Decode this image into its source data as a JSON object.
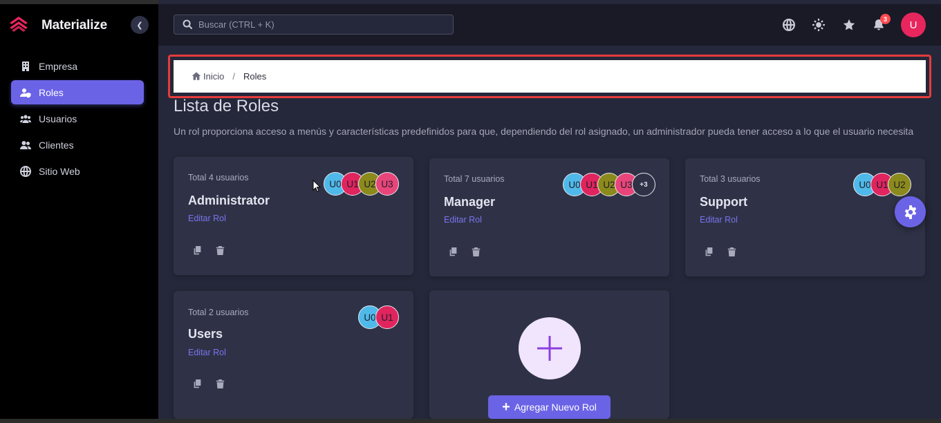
{
  "brand": {
    "name": "Materialize",
    "accent": "#e8265e"
  },
  "sidebar": {
    "items": [
      {
        "label": "Empresa",
        "icon": "building-icon",
        "active": false
      },
      {
        "label": "Roles",
        "icon": "user-shield-icon",
        "active": true
      },
      {
        "label": "Usuarios",
        "icon": "users-icon",
        "active": false
      },
      {
        "label": "Clientes",
        "icon": "user-group-icon",
        "active": false
      },
      {
        "label": "Sitio Web",
        "icon": "globe-icon",
        "active": false
      }
    ]
  },
  "topbar": {
    "search_placeholder": "Buscar (CTRL + K)",
    "notification_count": "3",
    "user_initial": "U"
  },
  "breadcrumb": {
    "home": "Inicio",
    "separator": "/",
    "current": "Roles"
  },
  "page": {
    "title": "Lista de Roles",
    "description": "Un rol proporciona acceso a menús y características predefinidos para que, dependiendo del rol asignado, un administrador pueda tener acceso a lo que el usuario necesita"
  },
  "roles": [
    {
      "total": "Total 4 usuarios",
      "name": "Administrator",
      "edit": "Editar Rol",
      "avatars": [
        "U0",
        "U1",
        "U2",
        "U3"
      ],
      "more": ""
    },
    {
      "total": "Total 7 usuarios",
      "name": "Manager",
      "edit": "Editar Rol",
      "avatars": [
        "U0",
        "U1",
        "U2",
        "U3"
      ],
      "more": "+3"
    },
    {
      "total": "Total 3 usuarios",
      "name": "Support",
      "edit": "Editar Rol",
      "avatars": [
        "U0",
        "U1",
        "U2"
      ],
      "more": ""
    },
    {
      "total": "Total 2 usuarios",
      "name": "Users",
      "edit": "Editar Rol",
      "avatars": [
        "U0",
        "U1"
      ],
      "more": ""
    }
  ],
  "avatar_colors": [
    "#4fb9ea",
    "#e0245e",
    "#8b8a1c",
    "#e8457a"
  ],
  "add_role": {
    "label": "Agregar Nuevo Rol"
  },
  "colors": {
    "primary": "#6b63e6",
    "background": "#25283a",
    "card": "#2f3246",
    "highlight_border": "#e63b3b"
  }
}
